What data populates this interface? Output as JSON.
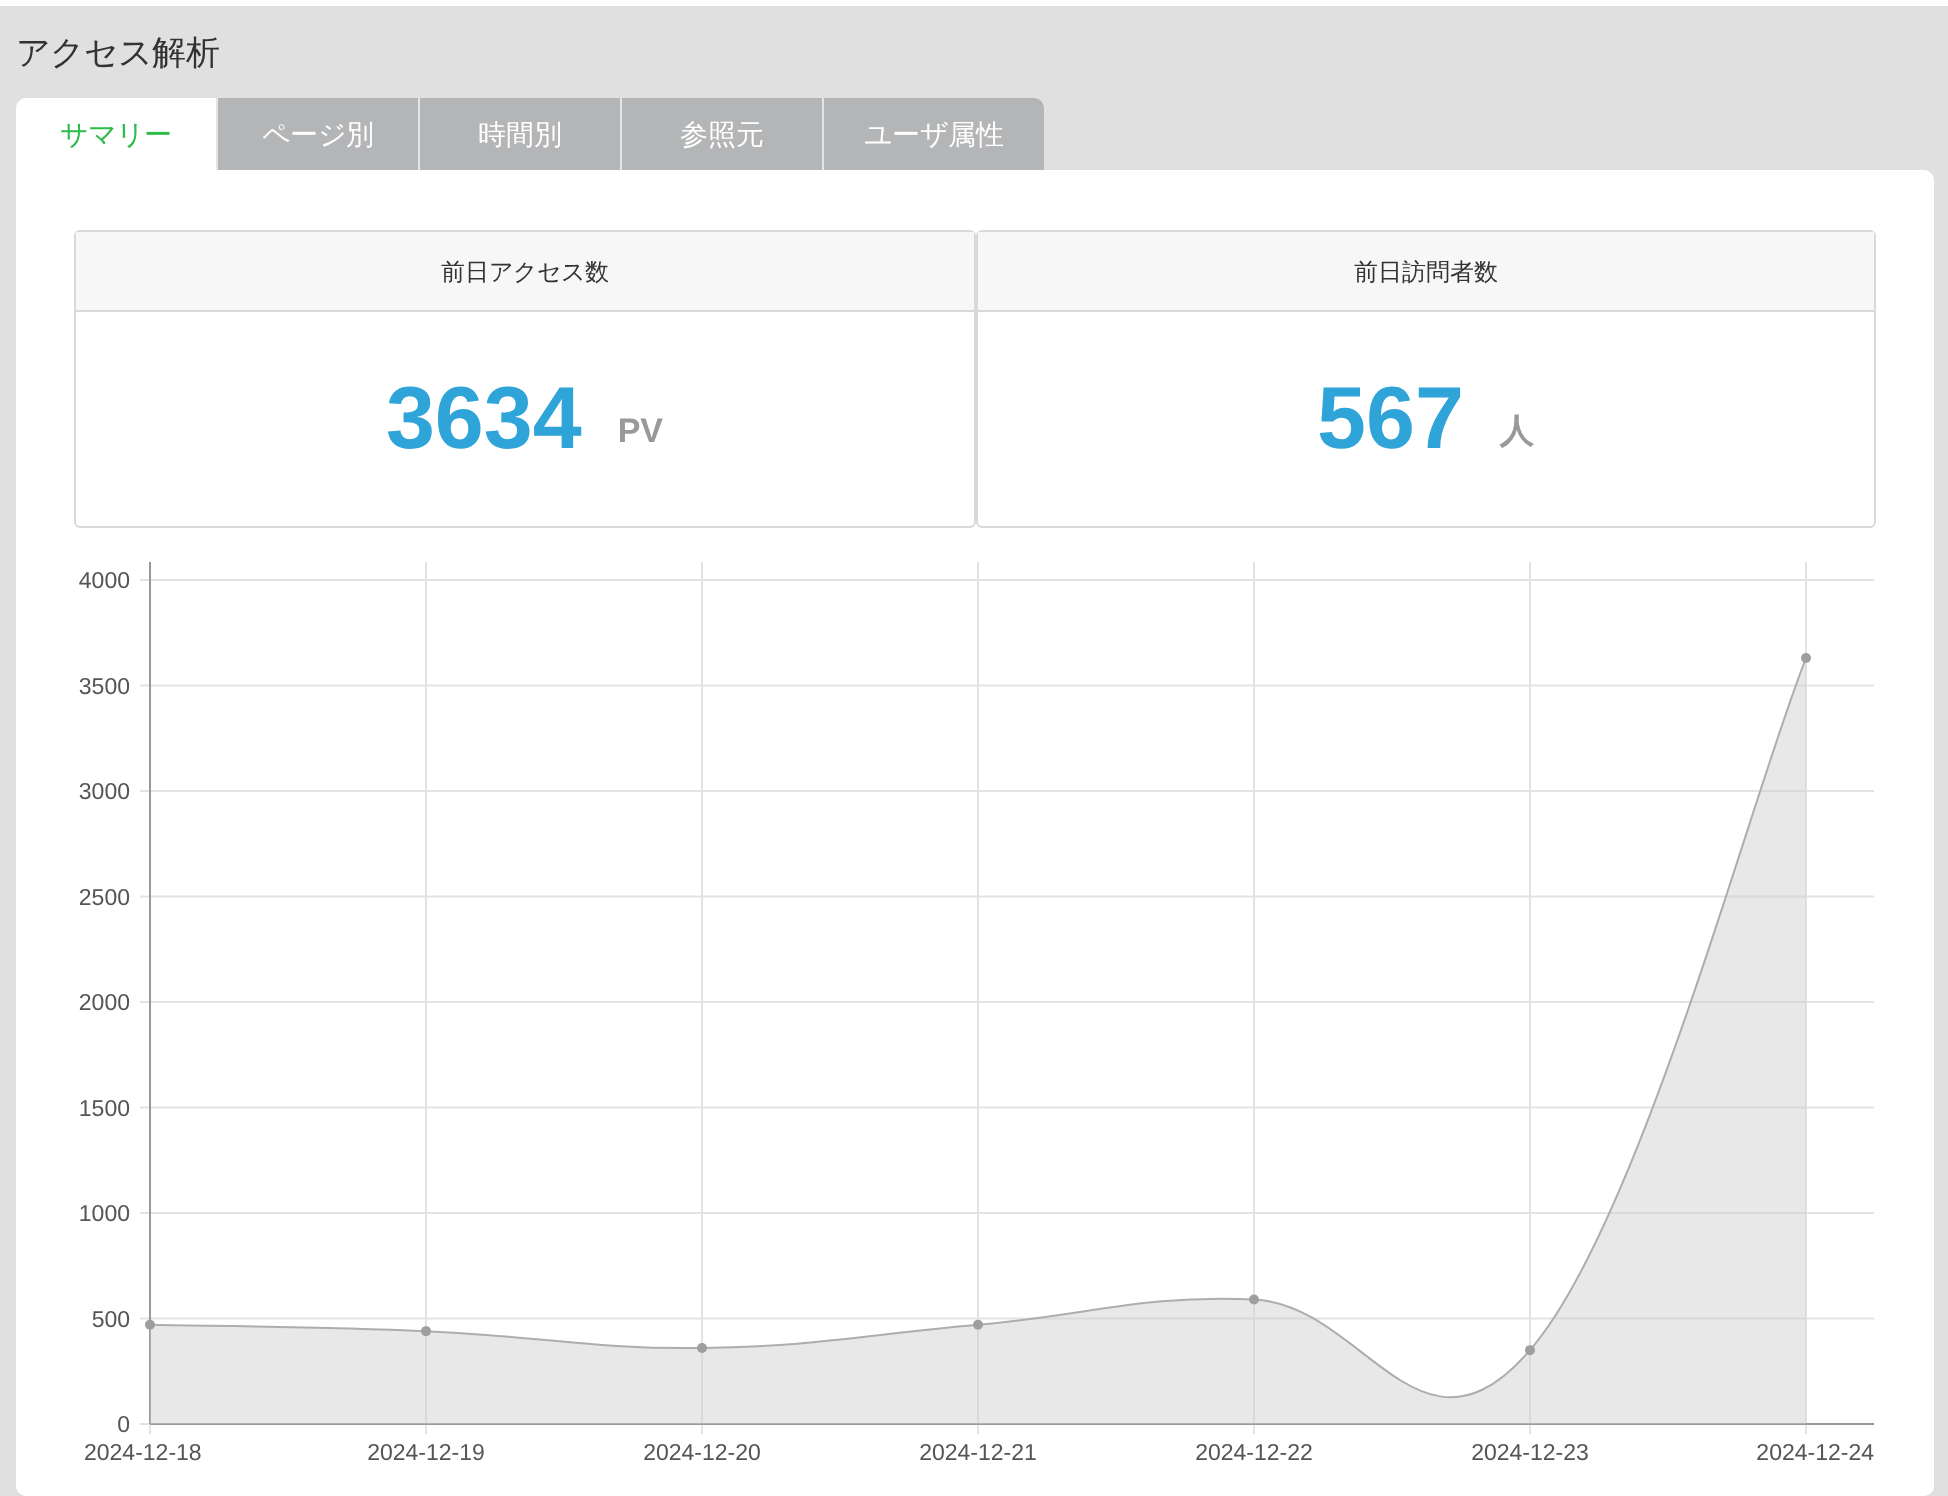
{
  "title": "アクセス解析",
  "tabs": [
    {
      "label": "サマリー",
      "selected": true
    },
    {
      "label": "ページ別",
      "selected": false
    },
    {
      "label": "時間別",
      "selected": false
    },
    {
      "label": "参照元",
      "selected": false
    },
    {
      "label": "ユーザ属性",
      "selected": false
    }
  ],
  "stats": [
    {
      "label": "前日アクセス数",
      "value": "3634",
      "unit": "PV"
    },
    {
      "label": "前日訪問者数",
      "value": "567",
      "unit": "人"
    }
  ],
  "chart": {
    "chart_data": {
      "type": "area",
      "categories": [
        "2024-12-18",
        "2024-12-19",
        "2024-12-20",
        "2024-12-21",
        "2024-12-22",
        "2024-12-23",
        "2024-12-24"
      ],
      "ylim": [
        0,
        4000
      ],
      "grid": true,
      "yticks": [
        0,
        500,
        1000,
        1500,
        2000,
        2500,
        3000,
        3500,
        4000
      ],
      "series": [
        {
          "color": "#cccccc",
          "values": [
            470,
            440,
            360,
            470,
            590,
            350,
            3630
          ]
        }
      ]
    }
  }
}
